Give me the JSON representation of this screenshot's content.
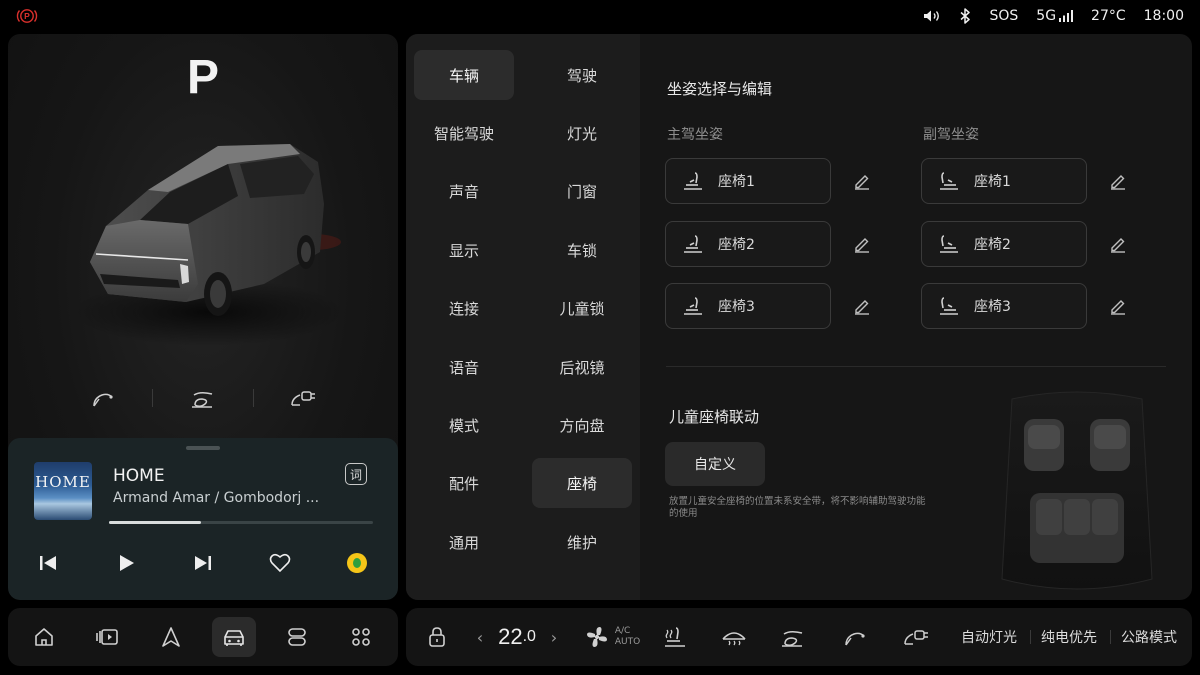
{
  "status_bar": {
    "park_indicator": "park-brake-icon",
    "volume_icon": "speaker-icon",
    "bluetooth_icon": "bluetooth-icon",
    "sos": "SOS",
    "network": "5G",
    "temperature": "27°C",
    "time": "18:00",
    "park_color": "#d9302c"
  },
  "vehicle": {
    "gear": "P",
    "controls": [
      "fuel-door-icon",
      "charge-port-icon",
      "power-socket-icon"
    ]
  },
  "media": {
    "album_text": "HOME",
    "track_title": "HOME",
    "artist": "Armand Amar / Gombodorj ...",
    "lyrics_label": "词",
    "progress_fraction": 0.35,
    "controls": [
      "previous-icon",
      "play-icon",
      "next-icon",
      "favorite-icon",
      "music-app-icon"
    ]
  },
  "dock": {
    "items": [
      "home-icon",
      "media-icon",
      "navigation-icon",
      "car-icon",
      "apps-switch-icon",
      "app-grid-icon"
    ],
    "active_index": 3
  },
  "settings_nav": {
    "left": [
      "车辆",
      "智能驾驶",
      "声音",
      "显示",
      "连接",
      "语音",
      "模式",
      "配件",
      "通用"
    ],
    "right": [
      "驾驶",
      "灯光",
      "门窗",
      "车锁",
      "儿童锁",
      "后视镜",
      "方向盘",
      "座椅",
      "维护"
    ],
    "active": "座椅"
  },
  "seat_settings": {
    "section_title": "坐姿选择与编辑",
    "driver_label": "主驾坐姿",
    "passenger_label": "副驾坐姿",
    "driver_seats": [
      "座椅1",
      "座椅2",
      "座椅3"
    ],
    "passenger_seats": [
      "座椅1",
      "座椅2",
      "座椅3"
    ],
    "child_seat_title": "儿童座椅联动",
    "custom_button": "自定义",
    "hint": "放置儿童安全座椅的位置未系安全带，将不影响辅助驾驶功能的使用"
  },
  "climate": {
    "temperature_int": "22",
    "temperature_dec": ".0",
    "left_arrow": "‹",
    "right_arrow": "›",
    "ac_line1": "A/C",
    "ac_line2": "AUTO",
    "auto_lights": "自动灯光",
    "pure_electric": "纯电优先",
    "road_mode": "公路模式"
  }
}
